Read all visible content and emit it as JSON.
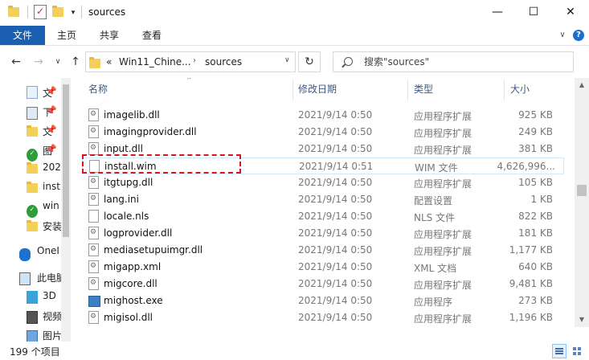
{
  "window": {
    "title": "sources",
    "minimize": "—",
    "maximize": "☐",
    "close": "✕"
  },
  "ribbon": {
    "tabs": [
      "文件",
      "主页",
      "共享",
      "查看"
    ],
    "expand_glyph": "∨",
    "help_glyph": "?"
  },
  "nav": {
    "back": "←",
    "forward": "→",
    "recent": "∨",
    "up": "↑",
    "breadcrumb_overflow": "«",
    "breadcrumb": [
      "Win11_Chine...",
      "sources"
    ],
    "breadcrumb_sep": "›",
    "address_dropdown": "∨",
    "refresh": "↻",
    "search_placeholder": "搜索\"sources\""
  },
  "navpane": {
    "items": [
      {
        "label": "文",
        "icon": "document-icon",
        "pinned": true
      },
      {
        "label": "下",
        "icon": "image-icon",
        "pinned": true
      },
      {
        "label": "文",
        "icon": "folder-icon",
        "pinned": true
      },
      {
        "label": "图",
        "icon": "status-ok-icon",
        "pinned": true
      },
      {
        "label": "202",
        "icon": "folder-icon",
        "pinned": false
      },
      {
        "label": "inst",
        "icon": "folder-icon",
        "pinned": false
      },
      {
        "label": "win",
        "icon": "status-ok-icon",
        "pinned": false
      },
      {
        "label": "安装",
        "icon": "folder-icon",
        "pinned": false
      },
      {
        "label": "OneI",
        "icon": "onedrive-cloud-icon",
        "pinned": false
      },
      {
        "label": "此电脑",
        "icon": "this-pc-icon",
        "pinned": false
      },
      {
        "label": "3D",
        "icon": "3d-objects-icon",
        "pinned": false
      },
      {
        "label": "视频",
        "icon": "videos-icon",
        "pinned": false
      },
      {
        "label": "图片",
        "icon": "pictures-icon",
        "pinned": false
      }
    ],
    "pin_glyph": "📌"
  },
  "columns": {
    "name": "名称",
    "date": "修改日期",
    "type": "类型",
    "size": "大小",
    "sort_glyph": "^"
  },
  "files": [
    {
      "name": "imagelib.dll",
      "date": "2021/9/14 0:50",
      "type": "应用程序扩展",
      "size": "925 KB",
      "icon": "gear-file-icon"
    },
    {
      "name": "imagingprovider.dll",
      "date": "2021/9/14 0:50",
      "type": "应用程序扩展",
      "size": "249 KB",
      "icon": "gear-file-icon"
    },
    {
      "name": "input.dll",
      "date": "2021/9/14 0:50",
      "type": "应用程序扩展",
      "size": "381 KB",
      "icon": "gear-file-icon"
    },
    {
      "name": "install.wim",
      "date": "2021/9/14 0:51",
      "type": "WIM 文件",
      "size": "4,626,996...",
      "icon": "blank-file-icon"
    },
    {
      "name": "itgtupg.dll",
      "date": "2021/9/14 0:50",
      "type": "应用程序扩展",
      "size": "105 KB",
      "icon": "gear-file-icon"
    },
    {
      "name": "lang.ini",
      "date": "2021/9/14 0:50",
      "type": "配置设置",
      "size": "1 KB",
      "icon": "gear-file-icon"
    },
    {
      "name": "locale.nls",
      "date": "2021/9/14 0:50",
      "type": "NLS 文件",
      "size": "822 KB",
      "icon": "blank-file-icon"
    },
    {
      "name": "logprovider.dll",
      "date": "2021/9/14 0:50",
      "type": "应用程序扩展",
      "size": "181 KB",
      "icon": "gear-file-icon"
    },
    {
      "name": "mediasetupuimgr.dll",
      "date": "2021/9/14 0:50",
      "type": "应用程序扩展",
      "size": "1,177 KB",
      "icon": "gear-file-icon"
    },
    {
      "name": "migapp.xml",
      "date": "2021/9/14 0:50",
      "type": "XML 文档",
      "size": "640 KB",
      "icon": "gear-file-icon"
    },
    {
      "name": "migcore.dll",
      "date": "2021/9/14 0:50",
      "type": "应用程序扩展",
      "size": "9,481 KB",
      "icon": "gear-file-icon"
    },
    {
      "name": "mighost.exe",
      "date": "2021/9/14 0:50",
      "type": "应用程序",
      "size": "273 KB",
      "icon": "exe-file-icon"
    },
    {
      "name": "migisol.dll",
      "date": "2021/9/14 0:50",
      "type": "应用程序扩展",
      "size": "1,196 KB",
      "icon": "gear-file-icon"
    }
  ],
  "scrollbar": {
    "up": "▲",
    "down": "▼"
  },
  "status": {
    "item_count": "199 个项目"
  },
  "colors": {
    "file_tab": "#1b5fb1",
    "highlight_box": "#d8141c",
    "header_text": "#3c5a86"
  }
}
